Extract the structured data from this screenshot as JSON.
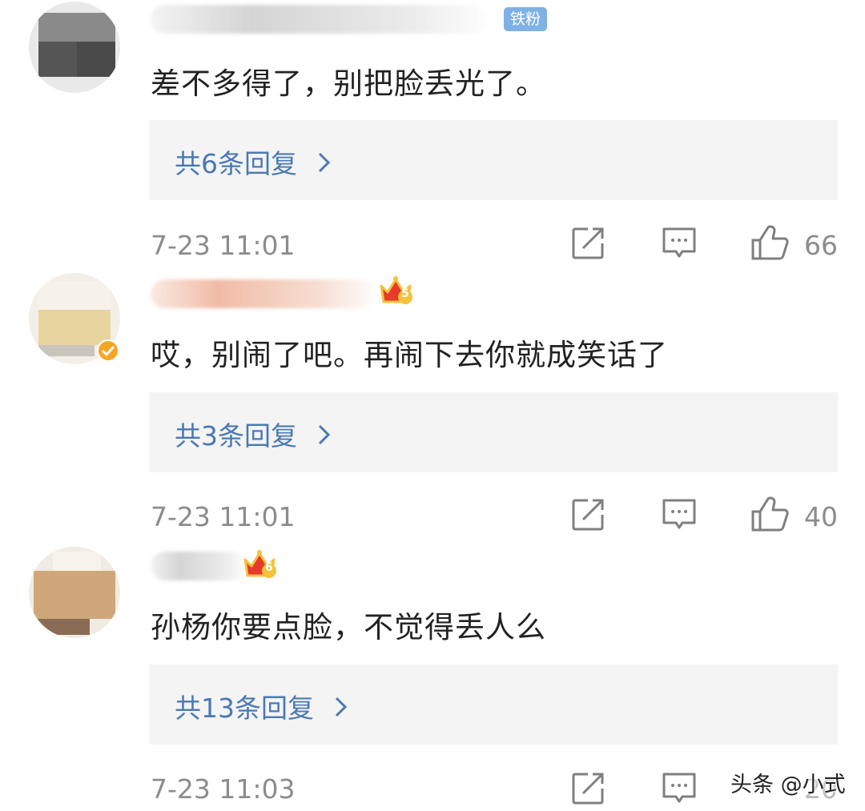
{
  "comments": [
    {
      "badge": "铁粉",
      "text": "差不多得了，别把脸丢光了。",
      "replies_label": "共6条回复",
      "time": "7-23 11:01",
      "likes": "66"
    },
    {
      "crown_level": "5",
      "text": "哎，别闹了吧。再闹下去你就成笑话了",
      "replies_label": "共3条回复",
      "time": "7-23 11:01",
      "likes": "40"
    },
    {
      "crown_level": "6",
      "text": "孙杨你要点脸，不觉得丢人么",
      "replies_label": "共13条回复",
      "time": "7-23 11:03",
      "likes": "20"
    }
  ],
  "icons": {
    "share": "share-icon",
    "reply": "comment-icon",
    "like": "thumbs-up-icon",
    "chevron": "chevron-right-icon"
  },
  "colors": {
    "link": "#4b79b3",
    "muted": "#8c8c8c",
    "fan_badge": "#7fb1e6",
    "crown": "#e83a2c"
  },
  "watermark": "头条 @小式"
}
